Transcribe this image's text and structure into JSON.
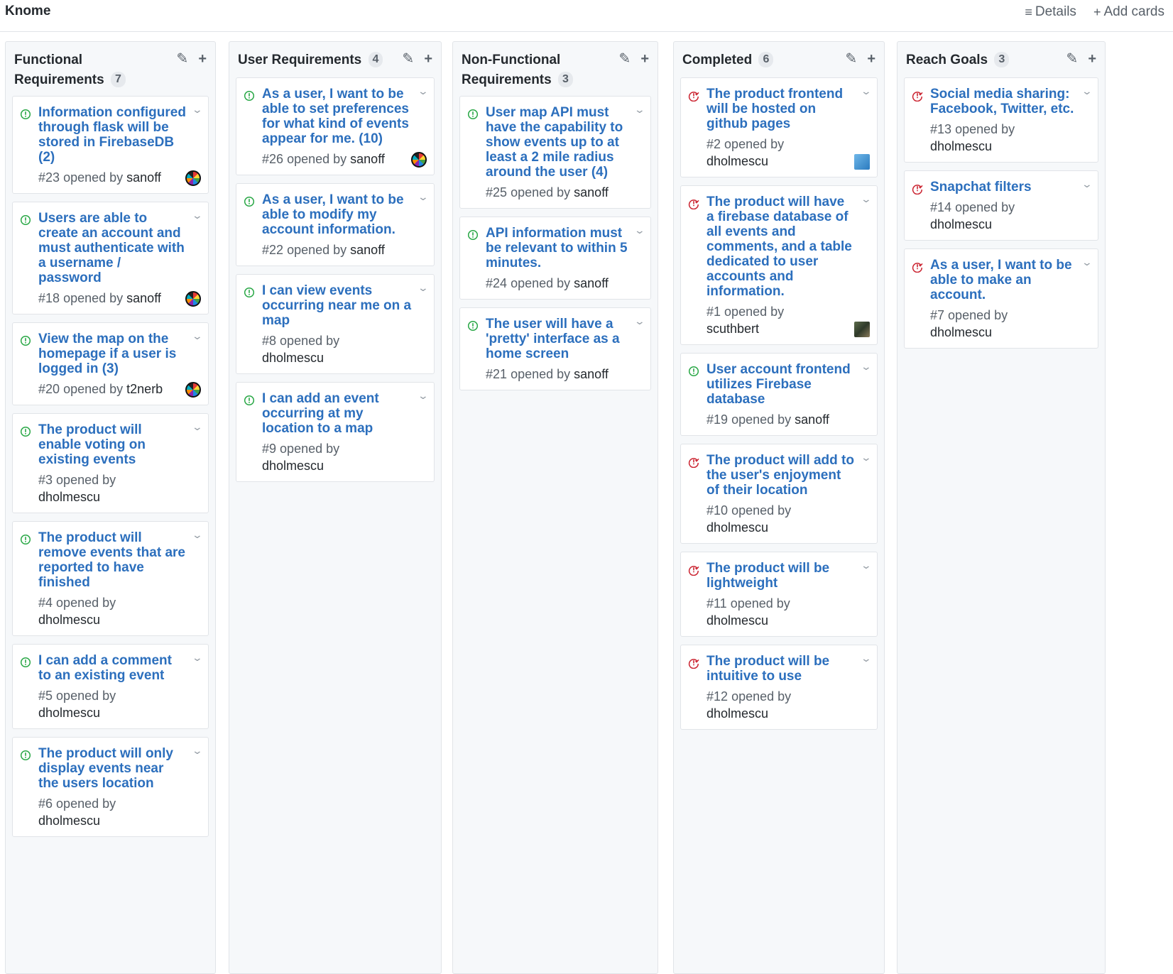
{
  "board": {
    "title": "Knome"
  },
  "toolbar": {
    "details_label": "Details",
    "add_cards_label": "Add cards",
    "details_icon": "menu-icon",
    "add_icon": "plus-icon"
  },
  "colors": {
    "open_issue": "#28a745",
    "closed_issue": "#cb2431",
    "link": "#2c6fbd"
  },
  "columns": [
    {
      "name": "Functional Requirements",
      "count": "7",
      "cards": [
        {
          "title": "Information configured through flask will be stored in FirebaseDB (2)",
          "number": "#23",
          "opened_by": "opened by",
          "user": "sanoff",
          "state": "open",
          "avatar": "circle"
        },
        {
          "title": "Users are able to create an account and must authenticate with a username / password",
          "number": "#18",
          "opened_by": "opened by",
          "user": "sanoff",
          "state": "open",
          "avatar": "circle"
        },
        {
          "title": "View the map on the homepage if a user is logged in (3)",
          "number": "#20",
          "opened_by": "opened by",
          "user": "t2nerb",
          "state": "open",
          "avatar": "circle"
        },
        {
          "title": "The product will enable voting on existing events",
          "number": "#3",
          "opened_by": "opened by",
          "user": "dholmescu",
          "state": "open",
          "avatar": ""
        },
        {
          "title": "The product will remove events that are reported to have finished",
          "number": "#4",
          "opened_by": "opened by",
          "user": "dholmescu",
          "state": "open",
          "avatar": ""
        },
        {
          "title": "I can add a comment to an existing event",
          "number": "#5",
          "opened_by": "opened by",
          "user": "dholmescu",
          "state": "open",
          "avatar": ""
        },
        {
          "title": "The product will only display events near the users location",
          "number": "#6",
          "opened_by": "opened by",
          "user": "dholmescu",
          "state": "open",
          "avatar": ""
        }
      ]
    },
    {
      "name": "User Requirements",
      "count": "4",
      "cards": [
        {
          "title": "As a user, I want to be able to set preferences for what kind of events appear for me. (10)",
          "number": "#26",
          "opened_by": "opened by",
          "user": "sanoff",
          "state": "open",
          "avatar": "circle"
        },
        {
          "title": "As a user, I want to be able to modify my account information.",
          "number": "#22",
          "opened_by": "opened by",
          "user": "sanoff",
          "state": "open",
          "avatar": ""
        },
        {
          "title": "I can view events occurring near me on a map",
          "number": "#8",
          "opened_by": "opened by",
          "user": "dholmescu",
          "state": "open",
          "avatar": ""
        },
        {
          "title": "I can add an event occurring at my location to a map",
          "number": "#9",
          "opened_by": "opened by",
          "user": "dholmescu",
          "state": "open",
          "avatar": ""
        }
      ]
    },
    {
      "name": "Non-Functional Requirements",
      "count": "3",
      "cards": [
        {
          "title": "User map API must have the capability to show events up to at least a 2 mile radius around the user (4)",
          "number": "#25",
          "opened_by": "opened by",
          "user": "sanoff",
          "state": "open",
          "avatar": ""
        },
        {
          "title": "API information must be relevant to within 5 minutes.",
          "number": "#24",
          "opened_by": "opened by",
          "user": "sanoff",
          "state": "open",
          "avatar": ""
        },
        {
          "title": "The user will have a 'pretty' interface as a home screen",
          "number": "#21",
          "opened_by": "opened by",
          "user": "sanoff",
          "state": "open",
          "avatar": ""
        }
      ]
    },
    {
      "name": "Completed",
      "count": "6",
      "cards": [
        {
          "title": "The product frontend will be hosted on github pages",
          "number": "#2",
          "opened_by": "opened by",
          "user": "dholmescu",
          "state": "closed",
          "avatar": "blue"
        },
        {
          "title": "The product will have a firebase database of all events and comments, and a table dedicated to user accounts and information.",
          "number": "#1",
          "opened_by": "opened by",
          "user": "scuthbert",
          "state": "closed",
          "avatar": "photo"
        },
        {
          "title": "User account frontend utilizes Firebase database",
          "number": "#19",
          "opened_by": "opened by",
          "user": "sanoff",
          "state": "open",
          "avatar": ""
        },
        {
          "title": "The product will add to the user's enjoyment of their location",
          "number": "#10",
          "opened_by": "opened by",
          "user": "dholmescu",
          "state": "closed",
          "avatar": ""
        },
        {
          "title": "The product will be lightweight",
          "number": "#11",
          "opened_by": "opened by",
          "user": "dholmescu",
          "state": "closed",
          "avatar": ""
        },
        {
          "title": "The product will be intuitive to use",
          "number": "#12",
          "opened_by": "opened by",
          "user": "dholmescu",
          "state": "closed",
          "avatar": ""
        }
      ]
    },
    {
      "name": "Reach Goals",
      "count": "3",
      "cards": [
        {
          "title": "Social media sharing: Facebook, Twitter, etc.",
          "number": "#13",
          "opened_by": "opened by",
          "user": "dholmescu",
          "state": "closed",
          "avatar": ""
        },
        {
          "title": "Snapchat filters",
          "number": "#14",
          "opened_by": "opened by",
          "user": "dholmescu",
          "state": "closed",
          "avatar": ""
        },
        {
          "title": "As a user, I want to be able to make an account.",
          "number": "#7",
          "opened_by": "opened by",
          "user": "dholmescu",
          "state": "closed",
          "avatar": ""
        }
      ]
    }
  ]
}
